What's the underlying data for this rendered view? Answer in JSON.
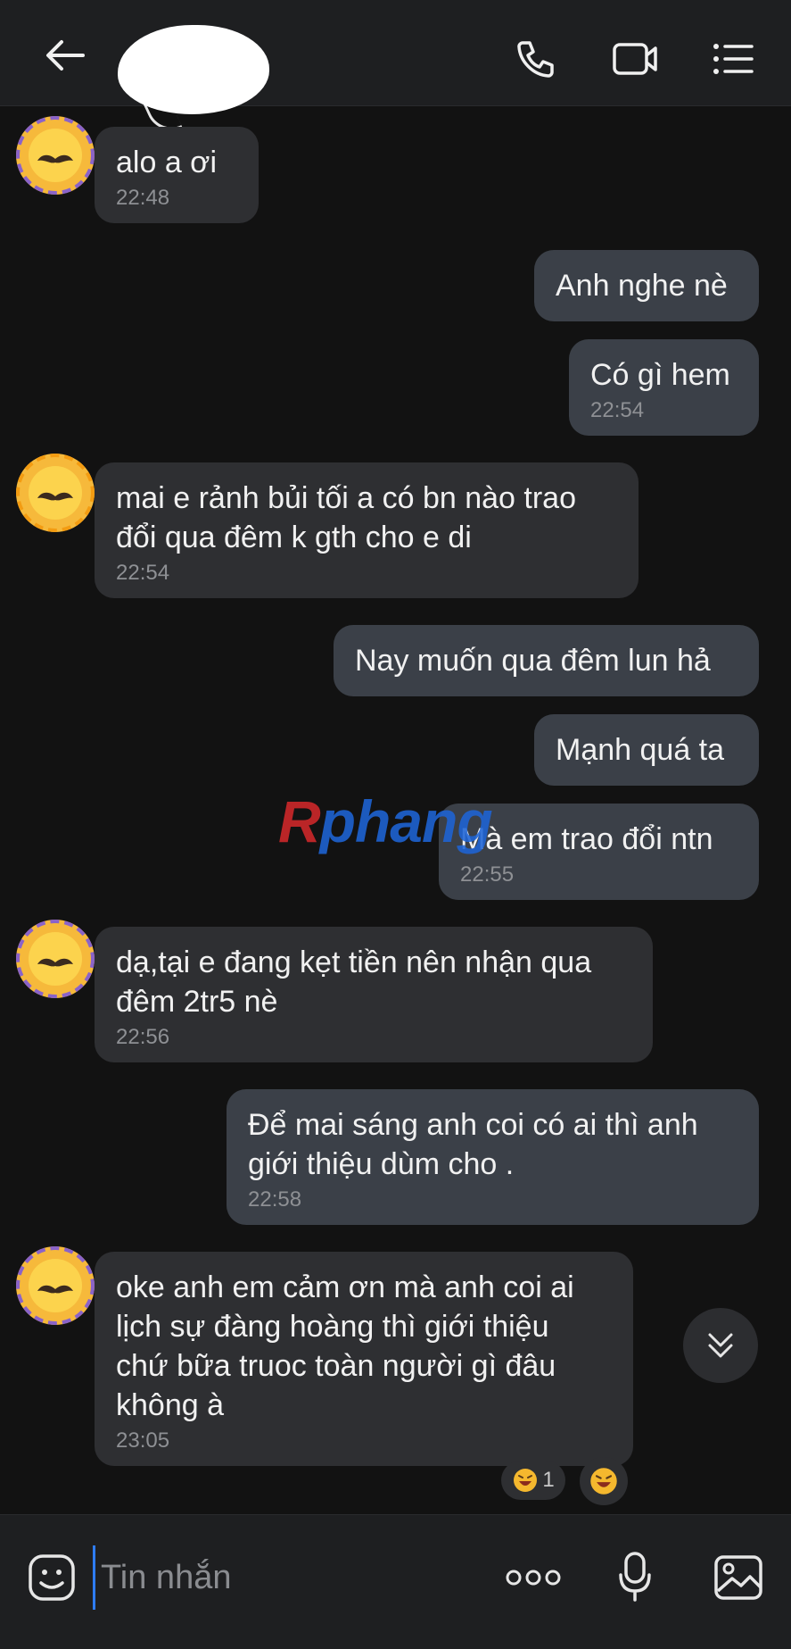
{
  "header": {
    "contact_name": "",
    "icons": {
      "back": "arrow-left-icon",
      "call": "phone-icon",
      "video": "video-camera-icon",
      "menu": "list-menu-icon"
    }
  },
  "messages": [
    {
      "side": "in",
      "text": "alo a ơi",
      "time": "22:48"
    },
    {
      "side": "out",
      "text": "Anh nghe nè",
      "time": ""
    },
    {
      "side": "out",
      "text": "Có gì hem",
      "time": "22:54"
    },
    {
      "side": "in",
      "text": "mai e rảnh bủi tối a có bn nào trao\nđổi qua đêm k gth cho e di",
      "time": "22:54"
    },
    {
      "side": "out",
      "text": "Nay muốn qua đêm lun hả",
      "time": ""
    },
    {
      "side": "out",
      "text": "Mạnh quá ta",
      "time": ""
    },
    {
      "side": "out",
      "text": "Mà em trao đổi ntn",
      "time": "22:55"
    },
    {
      "side": "in",
      "text": "dạ,tại e đang kẹt tiền nên nhận qua\nđêm 2tr5 nè",
      "time": "22:56"
    },
    {
      "side": "out",
      "text": "Để mai sáng anh coi có ai thì anh\ngiới thiệu dùm cho .",
      "time": "22:58"
    },
    {
      "side": "in",
      "text": "oke anh em cảm ơn mà anh coi ai\nlịch sự đàng hoàng thì giới thiệu\nchứ bữa truoc toàn người gì đâu\nkhông à",
      "time": "23:05"
    }
  ],
  "reactions": {
    "count_label": "1",
    "emoji": "laughing-emoji-icon"
  },
  "watermark": {
    "part1": "R",
    "part2": "phang"
  },
  "input": {
    "placeholder": "Tin nhắn",
    "value": ""
  },
  "colors": {
    "accent": "#2e7cf6",
    "bubble_in": "#2e2f32",
    "bubble_out": "#3b4048",
    "background": "#121212"
  }
}
